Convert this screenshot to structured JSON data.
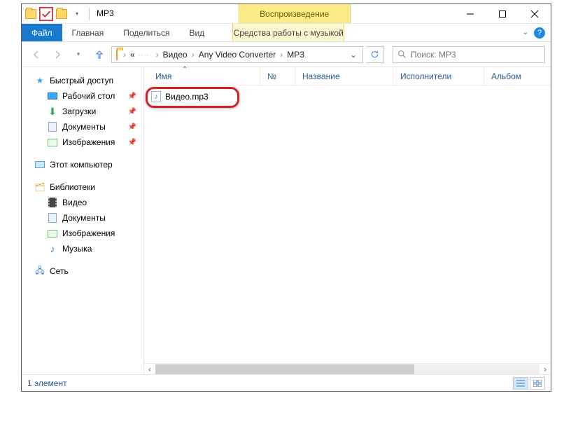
{
  "title": "MP3",
  "context_tab": "Воспроизведение",
  "context_lower": "Средства работы с музыкой",
  "ribbon": {
    "file": "Файл",
    "tabs": [
      "Главная",
      "Поделиться",
      "Вид"
    ]
  },
  "breadcrumb": {
    "hidden_prefix": "«",
    "blurred": "·····",
    "parts": [
      "Видео",
      "Any Video Converter",
      "MP3"
    ]
  },
  "search": {
    "placeholder": "Поиск: MP3"
  },
  "sidebar": {
    "quick": {
      "label": "Быстрый доступ",
      "items": [
        {
          "label": "Рабочий стол",
          "pinned": true
        },
        {
          "label": "Загрузки",
          "pinned": true
        },
        {
          "label": "Документы",
          "pinned": true
        },
        {
          "label": "Изображения",
          "pinned": true
        }
      ]
    },
    "pc": {
      "label": "Этот компьютер"
    },
    "libs": {
      "label": "Библиотеки",
      "items": [
        {
          "label": "Видео"
        },
        {
          "label": "Документы"
        },
        {
          "label": "Изображения"
        },
        {
          "label": "Музыка"
        }
      ]
    },
    "net": {
      "label": "Сеть"
    }
  },
  "columns": {
    "name": "Имя",
    "num": "№",
    "title": "Название",
    "artists": "Исполнители",
    "album": "Альбом"
  },
  "files": [
    {
      "name": "Видео.mp3"
    }
  ],
  "status": {
    "count": "1 элемент"
  }
}
